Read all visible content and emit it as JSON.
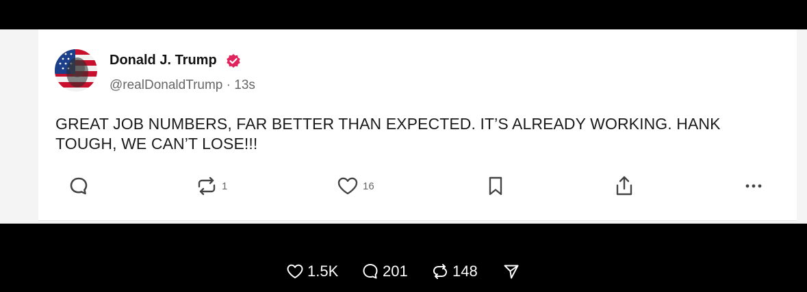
{
  "post": {
    "author_name": "Donald J. Trump",
    "handle": "@realDonaldTrump",
    "separator": "·",
    "time": "13s",
    "text": "GREAT JOB NUMBERS, FAR BETTER THAN EXPECTED. IT’S ALREADY WORKING. HANK TOUGH, WE CAN’T LOSE!!!",
    "actions": {
      "reply_count": "",
      "repost_count": "1",
      "like_count": "16"
    },
    "verified_color": "#e0245e"
  },
  "overlay_stats": {
    "likes": "1.5K",
    "comments": "201",
    "reposts": "148"
  },
  "icons": [
    "reply-icon",
    "repost-icon",
    "like-icon",
    "bookmark-icon",
    "share-icon",
    "more-icon",
    "heart-icon",
    "comment-icon",
    "reshare-icon",
    "send-icon"
  ]
}
